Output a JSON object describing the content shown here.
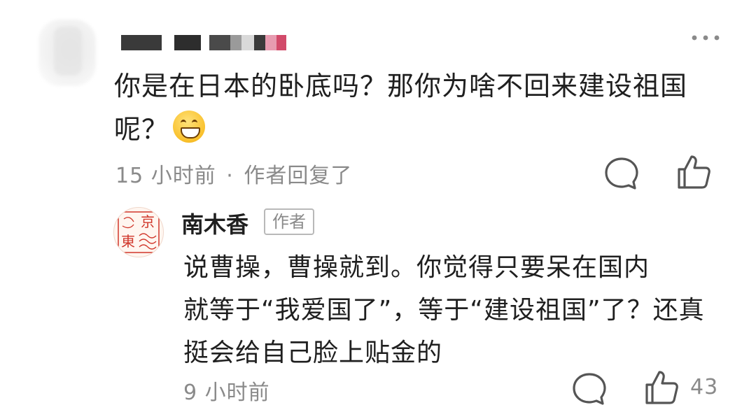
{
  "comment": {
    "text_line1": "你是在日本的卧底吗？那你为啥不回来建设祖国",
    "text_line2": "呢？",
    "emoji": "grinning-face-emoji",
    "time": "15 小时前",
    "separator": "·",
    "reply_note": "作者回复了"
  },
  "reply": {
    "author_name": "南木香",
    "author_tag": "作者",
    "avatar_seal": [
      "京",
      "東"
    ],
    "text_line1": "说曹操，曹操就到。你觉得只要呆在国内",
    "text_line2": "就等于“我爱国了”，等于“建设祖国”了？还真",
    "text_line3": "挺会给自己脸上贴金的",
    "time": "9 小时前",
    "like_count": "43"
  },
  "icons": {
    "more": "more-dots-icon",
    "comment": "comment-bubble-icon",
    "like": "thumbs-up-icon"
  },
  "colors": {
    "text_primary": "#1f1f1f",
    "text_secondary": "#8a8a8a",
    "seal_red": "#d0362a"
  }
}
